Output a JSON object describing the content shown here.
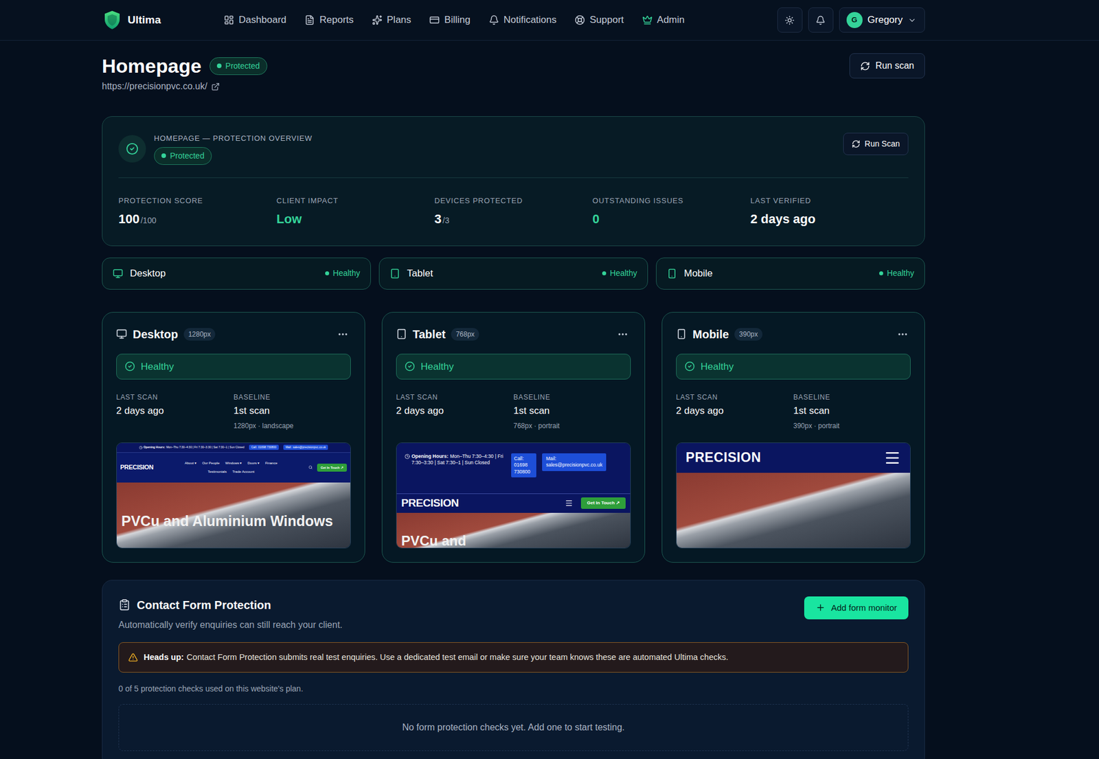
{
  "nav": {
    "brand": "Ultima",
    "items": [
      {
        "label": "Dashboard",
        "selected": false,
        "color": "#c4ccd8"
      },
      {
        "label": "Reports",
        "selected": false,
        "color": "#c4ccd8"
      },
      {
        "label": "Plans",
        "selected": false,
        "color": "#c4ccd8"
      },
      {
        "label": "Billing",
        "selected": false,
        "color": "#c4ccd8"
      },
      {
        "label": "Notifications",
        "selected": false,
        "color": "#c4ccd8"
      },
      {
        "label": "Support",
        "selected": false,
        "color": "#c4ccd8"
      },
      {
        "label": "Admin",
        "selected": false,
        "color": "#34d399"
      }
    ],
    "user": {
      "initial": "G",
      "name": "Gregory"
    }
  },
  "page": {
    "title": "Homepage",
    "status": "Protected",
    "url": "https://precisionpvc.co.uk/",
    "action": "Run scan"
  },
  "overview": {
    "title": "HOMEPAGE — PROTECTION OVERVIEW",
    "status": "Protected",
    "action": "Run Scan",
    "stats": [
      {
        "label": "PROTECTION SCORE",
        "value": "100",
        "suffix": "/100",
        "color": "#ffffff"
      },
      {
        "label": "CLIENT IMPACT",
        "value": "Low",
        "color": "#34d399"
      },
      {
        "label": "DEVICES PROTECTED",
        "value": "3",
        "suffix": "/3",
        "color": "#ffffff"
      },
      {
        "label": "OUTSTANDING ISSUES",
        "value": "0",
        "color": "#34d399"
      },
      {
        "label": "LAST VERIFIED",
        "value": "2 days ago",
        "color": "#ffffff"
      }
    ]
  },
  "device_status": [
    {
      "kind": "desktop",
      "name": "Desktop",
      "status": "Healthy"
    },
    {
      "kind": "tablet",
      "name": "Tablet",
      "status": "Healthy"
    },
    {
      "kind": "mobile",
      "name": "Mobile",
      "status": "Healthy"
    }
  ],
  "devices": [
    {
      "kind": "desktop",
      "name": "Desktop",
      "width": "1280px",
      "status": "Healthy",
      "last_scan_label": "LAST SCAN",
      "last_scan": "2 days ago",
      "baseline_label": "BASELINE",
      "baseline": "1st scan",
      "baseline_detail": "1280px · landscape",
      "preview": {
        "kind": "desktop",
        "hours_label": "Opening Hours:",
        "hours": "Mon–Thu 7:30–4:30 | Fri 7:30–3:30 | Sat 7:30–1 | Sun Closed",
        "call_label": "Call:",
        "call": "01698 730800",
        "mail_label": "Mail:",
        "mail": "sales@precisionpvc.co.uk",
        "logo": "PRECISION",
        "menu": [
          "About ▾",
          "Our People",
          "Windows ▾",
          "Doors ▾",
          "Finance",
          "Testimonials",
          "Trade Account"
        ],
        "cta": "Get In Touch ↗",
        "headline": "PVCu and Aluminium Windows"
      }
    },
    {
      "kind": "tablet",
      "name": "Tablet",
      "width": "768px",
      "status": "Healthy",
      "last_scan_label": "LAST SCAN",
      "last_scan": "2 days ago",
      "baseline_label": "BASELINE",
      "baseline": "1st scan",
      "baseline_detail": "768px · portrait",
      "preview": {
        "kind": "tablet",
        "hours_label": "Opening Hours:",
        "hours": "Mon–Thu 7:30–4:30 | Fri 7:30–3:30 | Sat 7:30–1 | Sun Closed",
        "call_label": "Call:",
        "call": "01698 730800",
        "mail_label": "Mail:",
        "mail": "sales@precisionpvc.co.uk",
        "logo": "PRECISION",
        "cta": "Get In Touch ↗",
        "headline": "PVCu and"
      }
    },
    {
      "kind": "mobile",
      "name": "Mobile",
      "width": "390px",
      "status": "Healthy",
      "last_scan_label": "LAST SCAN",
      "last_scan": "2 days ago",
      "baseline_label": "BASELINE",
      "baseline": "1st scan",
      "baseline_detail": "390px · portrait",
      "preview": {
        "kind": "mobile",
        "logo": "PRECISION"
      }
    }
  ],
  "contact": {
    "title": "Contact Form Protection",
    "subtitle": "Automatically verify enquiries can still reach your client.",
    "action": "Add form monitor",
    "notice_label": "Heads up:",
    "notice": "Contact Form Protection submits real test enquiries. Use a dedicated test email or make sure your team knows these are automated Ultima checks.",
    "usage": "0 of 5 protection checks used on this website's plan.",
    "empty": "No form protection checks yet. Add one to start testing."
  }
}
